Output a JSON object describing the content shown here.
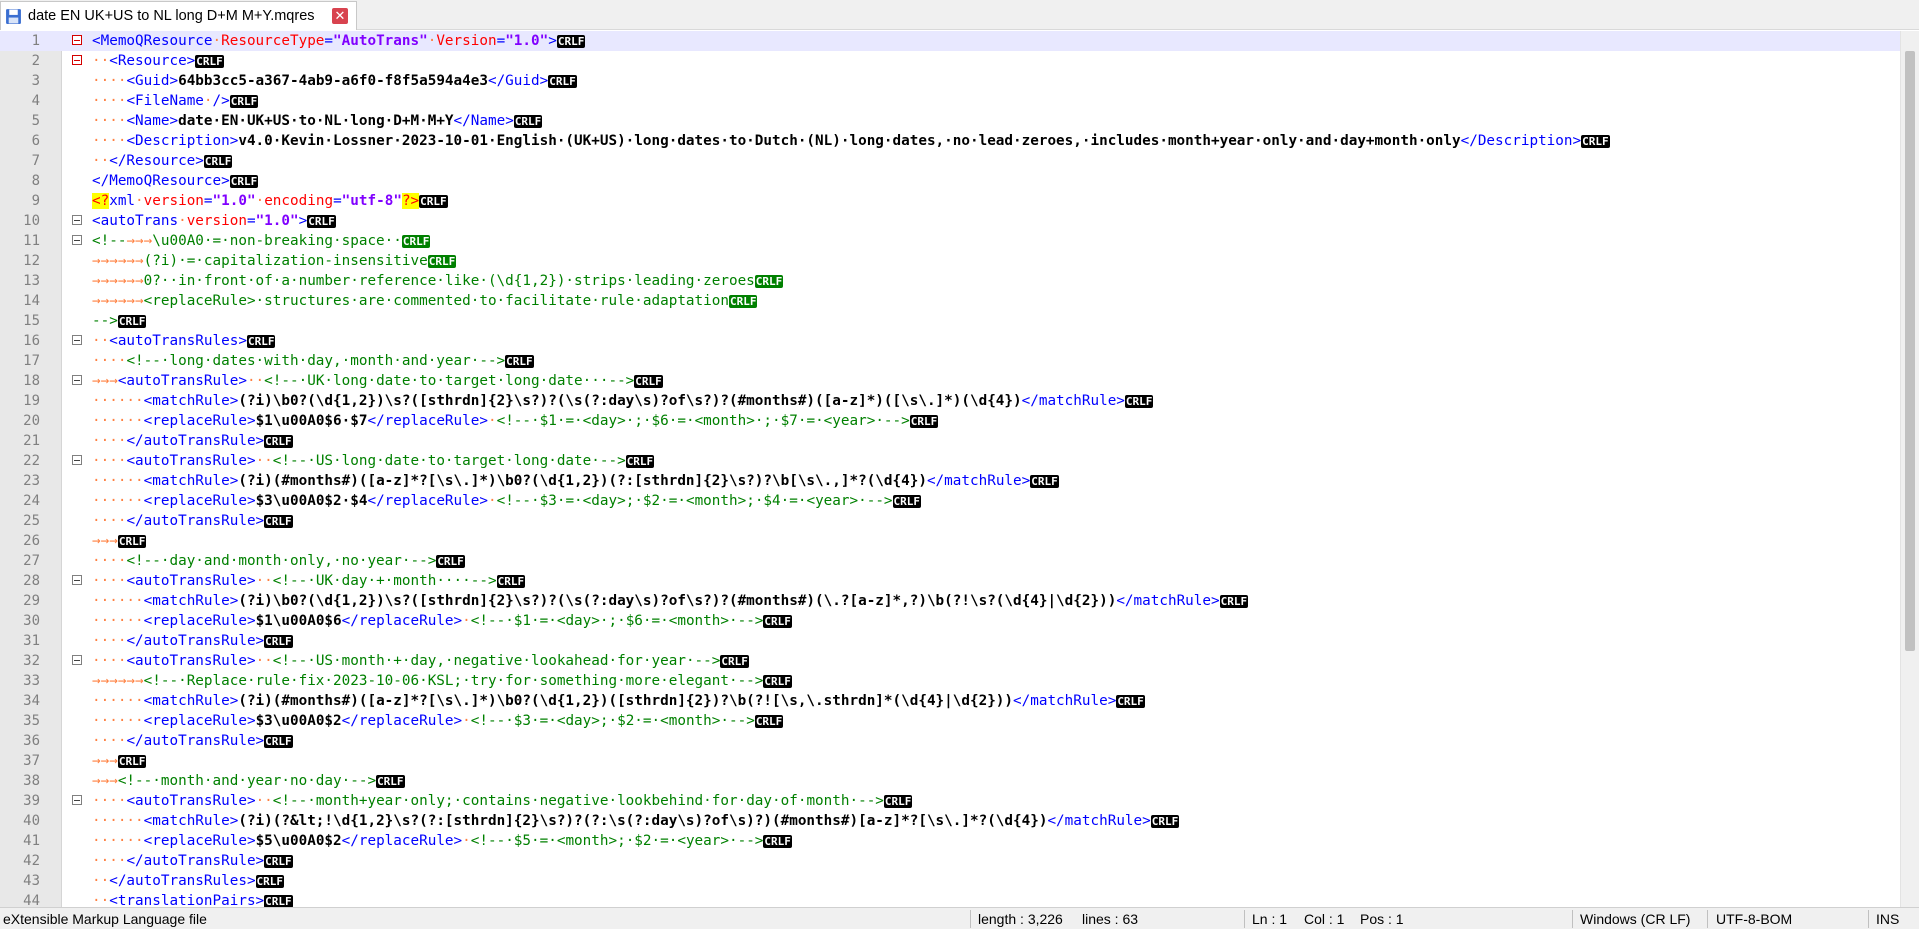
{
  "tab": {
    "title": "date EN UK+US to NL long D+M M+Y.mqres",
    "save_icon": "floppy-disk-icon",
    "close_icon": "close-icon"
  },
  "lines": [
    [
      [
        "tag",
        "<MemoQResource"
      ],
      [
        "ws",
        "·"
      ],
      [
        "attr",
        "ResourceType"
      ],
      [
        "tag",
        "="
      ],
      [
        "val",
        "\"AutoTrans\""
      ],
      [
        "ws",
        "·"
      ],
      [
        "attr",
        "Version"
      ],
      [
        "tag",
        "="
      ],
      [
        "val",
        "\"1.0\""
      ],
      [
        "tag",
        ">"
      ],
      [
        "crlf",
        "CRLF"
      ]
    ],
    [
      [
        "ws",
        "··"
      ],
      [
        "tag",
        "<Resource>"
      ],
      [
        "crlf",
        "CRLF"
      ]
    ],
    [
      [
        "ws",
        "····"
      ],
      [
        "tag",
        "<Guid>"
      ],
      [
        "txt",
        "64bb3cc5-a367-4ab9-a6f0-f8f5a594a4e3"
      ],
      [
        "tag",
        "</Guid>"
      ],
      [
        "crlf",
        "CRLF"
      ]
    ],
    [
      [
        "ws",
        "····"
      ],
      [
        "tag",
        "<FileName"
      ],
      [
        "ws",
        "·"
      ],
      [
        "tag",
        "/>"
      ],
      [
        "crlf",
        "CRLF"
      ]
    ],
    [
      [
        "ws",
        "····"
      ],
      [
        "tag",
        "<Name>"
      ],
      [
        "txt",
        "date·EN·UK+US·to·NL·long·D+M·M+Y"
      ],
      [
        "tag",
        "</Name>"
      ],
      [
        "crlf",
        "CRLF"
      ]
    ],
    [
      [
        "ws",
        "····"
      ],
      [
        "tag",
        "<Description>"
      ],
      [
        "txt",
        "v4.0·Kevin·Lossner·2023-10-01·English·(UK+US)·long·dates·to·Dutch·(NL)·long·dates,·no·lead·zeroes,·includes·month+year·only·and·day+month·only"
      ],
      [
        "tag",
        "</Description>"
      ],
      [
        "crlf",
        "CRLF"
      ]
    ],
    [
      [
        "ws",
        "··"
      ],
      [
        "tag",
        "</Resource>"
      ],
      [
        "crlf",
        "CRLF"
      ]
    ],
    [
      [
        "tag",
        "</MemoQResource>"
      ],
      [
        "crlf",
        "CRLF"
      ]
    ],
    [
      [
        "pi",
        "<?"
      ],
      [
        "tag",
        "xml"
      ],
      [
        "ws",
        "·"
      ],
      [
        "attr",
        "version"
      ],
      [
        "tag",
        "="
      ],
      [
        "val",
        "\"1.0\""
      ],
      [
        "ws",
        "·"
      ],
      [
        "attr",
        "encoding"
      ],
      [
        "tag",
        "="
      ],
      [
        "val",
        "\"utf-8\""
      ],
      [
        "pi",
        "?>"
      ],
      [
        "crlf",
        "CRLF"
      ]
    ],
    [
      [
        "tag",
        "<autoTrans"
      ],
      [
        "ws",
        "·"
      ],
      [
        "attr",
        "version"
      ],
      [
        "tag",
        "="
      ],
      [
        "val",
        "\"1.0\""
      ],
      [
        "tag",
        ">"
      ],
      [
        "crlf",
        "CRLF"
      ]
    ],
    [
      [
        "cmt",
        "<!--"
      ],
      [
        "ws",
        "→→→"
      ],
      [
        "cmt",
        "\\u00A0·=·non-breaking·space··"
      ],
      [
        "crlfg",
        "CRLF"
      ]
    ],
    [
      [
        "ws",
        "→→→→→→"
      ],
      [
        "cmt",
        "(?i)·=·capitalization-insensitive"
      ],
      [
        "crlfg",
        "CRLF"
      ]
    ],
    [
      [
        "ws",
        "→→→→→→"
      ],
      [
        "cmt",
        "0?··in·front·of·a·number·reference·like·(\\d{1,2})·strips·leading·zeroes"
      ],
      [
        "crlfg",
        "CRLF"
      ]
    ],
    [
      [
        "ws",
        "→→→→→→"
      ],
      [
        "cmt",
        "<replaceRule>·structures·are·commented·to·facilitate·rule·adaptation"
      ],
      [
        "crlfg",
        "CRLF"
      ]
    ],
    [
      [
        "cmt",
        "-->"
      ],
      [
        "crlf",
        "CRLF"
      ]
    ],
    [
      [
        "ws",
        "··"
      ],
      [
        "tag",
        "<autoTransRules>"
      ],
      [
        "crlf",
        "CRLF"
      ]
    ],
    [
      [
        "ws",
        "····"
      ],
      [
        "cmt",
        "<!--·long·dates·with·day,·month·and·year·-->"
      ],
      [
        "crlf",
        "CRLF"
      ]
    ],
    [
      [
        "ws",
        "→→→"
      ],
      [
        "tag",
        "<autoTransRule>"
      ],
      [
        "ws",
        "··"
      ],
      [
        "cmt",
        "<!--·UK·long·date·to·target·long·date···-->"
      ],
      [
        "crlf",
        "CRLF"
      ]
    ],
    [
      [
        "ws",
        "······"
      ],
      [
        "tag",
        "<matchRule>"
      ],
      [
        "txt",
        "(?i)\\b0?(\\d{1,2})\\s?([sthrdn]{2}\\s?)?(\\s(?:day\\s)?of\\s?)?(#months#)([a-z]*)([\\s\\.]*)(\\d{4})"
      ],
      [
        "tag",
        "</matchRule>"
      ],
      [
        "crlf",
        "CRLF"
      ]
    ],
    [
      [
        "ws",
        "······"
      ],
      [
        "tag",
        "<replaceRule>"
      ],
      [
        "txt",
        "$1\\u00A0$6·$7"
      ],
      [
        "tag",
        "</replaceRule>"
      ],
      [
        "ws",
        "·"
      ],
      [
        "cmt",
        "<!--·$1·=·<day>·;·$6·=·<month>·;·$7·=·<year>·-->"
      ],
      [
        "crlf",
        "CRLF"
      ]
    ],
    [
      [
        "ws",
        "····"
      ],
      [
        "tag",
        "</autoTransRule>"
      ],
      [
        "crlf",
        "CRLF"
      ]
    ],
    [
      [
        "ws",
        "····"
      ],
      [
        "tag",
        "<autoTransRule>"
      ],
      [
        "ws",
        "··"
      ],
      [
        "cmt",
        "<!--·US·long·date·to·target·long·date·-->"
      ],
      [
        "crlf",
        "CRLF"
      ]
    ],
    [
      [
        "ws",
        "······"
      ],
      [
        "tag",
        "<matchRule>"
      ],
      [
        "txt",
        "(?i)(#months#)([a-z]*?[\\s\\.]*)\\b0?(\\d{1,2})(?:[sthrdn]{2}\\s?)?\\b[\\s\\.,]*?(\\d{4})"
      ],
      [
        "tag",
        "</matchRule>"
      ],
      [
        "crlf",
        "CRLF"
      ]
    ],
    [
      [
        "ws",
        "······"
      ],
      [
        "tag",
        "<replaceRule>"
      ],
      [
        "txt",
        "$3\\u00A0$2·$4"
      ],
      [
        "tag",
        "</replaceRule>"
      ],
      [
        "ws",
        "·"
      ],
      [
        "cmt",
        "<!--·$3·=·<day>;·$2·=·<month>;·$4·=·<year>·-->"
      ],
      [
        "crlf",
        "CRLF"
      ]
    ],
    [
      [
        "ws",
        "····"
      ],
      [
        "tag",
        "</autoTransRule>"
      ],
      [
        "crlf",
        "CRLF"
      ]
    ],
    [
      [
        "ws",
        "→→→"
      ],
      [
        "crlf",
        "CRLF"
      ]
    ],
    [
      [
        "ws",
        "····"
      ],
      [
        "cmt",
        "<!--·day·and·month·only,·no·year·-->"
      ],
      [
        "crlf",
        "CRLF"
      ]
    ],
    [
      [
        "ws",
        "····"
      ],
      [
        "tag",
        "<autoTransRule>"
      ],
      [
        "ws",
        "··"
      ],
      [
        "cmt",
        "<!--·UK·day·+·month····-->"
      ],
      [
        "crlf",
        "CRLF"
      ]
    ],
    [
      [
        "ws",
        "······"
      ],
      [
        "tag",
        "<matchRule>"
      ],
      [
        "txt",
        "(?i)\\b0?(\\d{1,2})\\s?([sthrdn]{2}\\s?)?(\\s(?:day\\s)?of\\s?)?(#months#)(\\.?[a-z]*,?)\\b(?!\\s?(\\d{4}|\\d{2}))"
      ],
      [
        "tag",
        "</matchRule>"
      ],
      [
        "crlf",
        "CRLF"
      ]
    ],
    [
      [
        "ws",
        "······"
      ],
      [
        "tag",
        "<replaceRule>"
      ],
      [
        "txt",
        "$1\\u00A0$6"
      ],
      [
        "tag",
        "</replaceRule>"
      ],
      [
        "ws",
        "·"
      ],
      [
        "cmt",
        "<!--·$1·=·<day>·;·$6·=·<month>·-->"
      ],
      [
        "crlf",
        "CRLF"
      ]
    ],
    [
      [
        "ws",
        "····"
      ],
      [
        "tag",
        "</autoTransRule>"
      ],
      [
        "crlf",
        "CRLF"
      ]
    ],
    [
      [
        "ws",
        "····"
      ],
      [
        "tag",
        "<autoTransRule>"
      ],
      [
        "ws",
        "··"
      ],
      [
        "cmt",
        "<!--·US·month·+·day,·negative·lookahead·for·year·-->"
      ],
      [
        "crlf",
        "CRLF"
      ]
    ],
    [
      [
        "ws",
        "→→→→→→"
      ],
      [
        "cmt",
        "<!--·Replace·rule·fix·2023-10-06·KSL;·try·for·something·more·elegant·-->"
      ],
      [
        "crlf",
        "CRLF"
      ]
    ],
    [
      [
        "ws",
        "······"
      ],
      [
        "tag",
        "<matchRule>"
      ],
      [
        "txt",
        "(?i)(#months#)([a-z]*?[\\s\\.]*)\\b0?(\\d{1,2})([sthrdn]{2})?\\b(?![\\s,\\.sthrdn]*(\\d{4}|\\d{2}))"
      ],
      [
        "tag",
        "</matchRule>"
      ],
      [
        "crlf",
        "CRLF"
      ]
    ],
    [
      [
        "ws",
        "······"
      ],
      [
        "tag",
        "<replaceRule>"
      ],
      [
        "txt",
        "$3\\u00A0$2"
      ],
      [
        "tag",
        "</replaceRule>"
      ],
      [
        "ws",
        "·"
      ],
      [
        "cmt",
        "<!--·$3·=·<day>;·$2·=·<month>·-->"
      ],
      [
        "crlf",
        "CRLF"
      ]
    ],
    [
      [
        "ws",
        "····"
      ],
      [
        "tag",
        "</autoTransRule>"
      ],
      [
        "crlf",
        "CRLF"
      ]
    ],
    [
      [
        "ws",
        "→→→"
      ],
      [
        "crlf",
        "CRLF"
      ]
    ],
    [
      [
        "ws",
        "→→→"
      ],
      [
        "cmt",
        "<!--·month·and·year·no·day·-->"
      ],
      [
        "crlf",
        "CRLF"
      ]
    ],
    [
      [
        "ws",
        "····"
      ],
      [
        "tag",
        "<autoTransRule>"
      ],
      [
        "ws",
        "··"
      ],
      [
        "cmt",
        "<!--·month+year·only;·contains·negative·lookbehind·for·day·of·month·-->"
      ],
      [
        "crlf",
        "CRLF"
      ]
    ],
    [
      [
        "ws",
        "······"
      ],
      [
        "tag",
        "<matchRule>"
      ],
      [
        "txt",
        "(?i)(?&lt;!\\d{1,2}\\s?(?:[sthrdn]{2}\\s?)?(?:\\s(?:day\\s)?of\\s)?)(#months#)[a-z]*?[\\s\\.]*?(\\d{4})"
      ],
      [
        "tag",
        "</matchRule>"
      ],
      [
        "crlf",
        "CRLF"
      ]
    ],
    [
      [
        "ws",
        "······"
      ],
      [
        "tag",
        "<replaceRule>"
      ],
      [
        "txt",
        "$5\\u00A0$2"
      ],
      [
        "tag",
        "</replaceRule>"
      ],
      [
        "ws",
        "·"
      ],
      [
        "cmt",
        "<!--·$5·=·<month>;·$2·=·<year>·-->"
      ],
      [
        "crlf",
        "CRLF"
      ]
    ],
    [
      [
        "ws",
        "····"
      ],
      [
        "tag",
        "</autoTransRule>"
      ],
      [
        "crlf",
        "CRLF"
      ]
    ],
    [
      [
        "ws",
        "··"
      ],
      [
        "tag",
        "</autoTransRules>"
      ],
      [
        "crlf",
        "CRLF"
      ]
    ],
    [
      [
        "ws",
        "··"
      ],
      [
        "tag",
        "<translationPairs>"
      ],
      [
        "crlf",
        "CRLF"
      ]
    ]
  ],
  "status": {
    "filetype": "eXtensible Markup Language file",
    "length": "length : 3,226",
    "lines": "lines : 63",
    "ln": "Ln : 1",
    "col": "Col : 1",
    "pos": "Pos : 1",
    "eol": "Windows (CR LF)",
    "encoding": "UTF-8-BOM",
    "mode": "INS"
  }
}
